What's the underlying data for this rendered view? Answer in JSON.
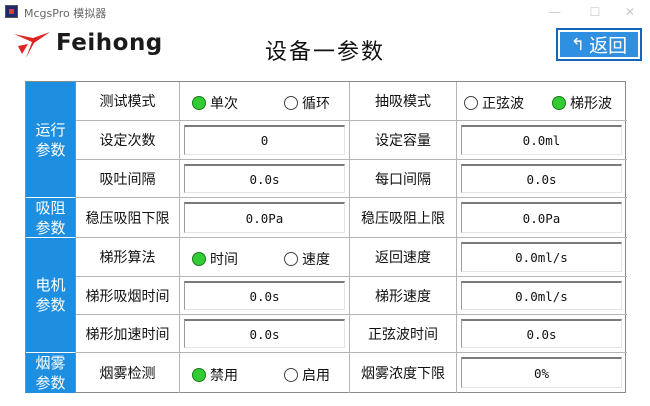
{
  "window": {
    "title": "McgsPro 模拟器",
    "minimize": "—",
    "maximize": "☐",
    "close": "✕"
  },
  "header": {
    "brand": "Feihong",
    "title": "设备一参数",
    "back_label": "返回",
    "back_icon": "↰"
  },
  "colors": {
    "accent": "#1e8fe0",
    "radio_on": "#33cc33",
    "back_bg": "#2f8fe0"
  },
  "sections": {
    "run": "运行\n参数",
    "resistance": "吸阻\n参数",
    "motor": "电机\n参数",
    "smoke": "烟雾\n参数"
  },
  "rows": {
    "test_mode": {
      "label": "测试模式",
      "opt1": "单次",
      "opt2": "循环",
      "selected": "单次"
    },
    "pump_mode": {
      "label": "抽吸模式",
      "opt1": "正弦波",
      "opt2": "梯形波",
      "selected": "梯形波"
    },
    "set_count": {
      "label": "设定次数",
      "value": "0"
    },
    "set_volume": {
      "label": "设定容量",
      "value": "0.0ml"
    },
    "puff_interval": {
      "label": "吸吐间隔",
      "value": "0.0s"
    },
    "port_interval": {
      "label": "每口间隔",
      "value": "0.0s"
    },
    "res_low": {
      "label": "稳压吸阻下限",
      "value": "0.0Pa"
    },
    "res_high": {
      "label": "稳压吸阻上限",
      "value": "0.0Pa"
    },
    "trap_algo": {
      "label": "梯形算法",
      "opt1": "时间",
      "opt2": "速度",
      "selected": "时间"
    },
    "return_speed": {
      "label": "返回速度",
      "value": "0.0ml/s"
    },
    "trap_time": {
      "label": "梯形吸烟时间",
      "value": "0.0s"
    },
    "trap_speed": {
      "label": "梯形速度",
      "value": "0.0ml/s"
    },
    "trap_accel": {
      "label": "梯形加速时间",
      "value": "0.0s"
    },
    "sine_time": {
      "label": "正弦波时间",
      "value": "0.0s"
    },
    "smoke_detect": {
      "label": "烟雾检测",
      "opt1": "禁用",
      "opt2": "启用",
      "selected": "禁用"
    },
    "smoke_low": {
      "label": "烟雾浓度下限",
      "value": "0%"
    }
  }
}
